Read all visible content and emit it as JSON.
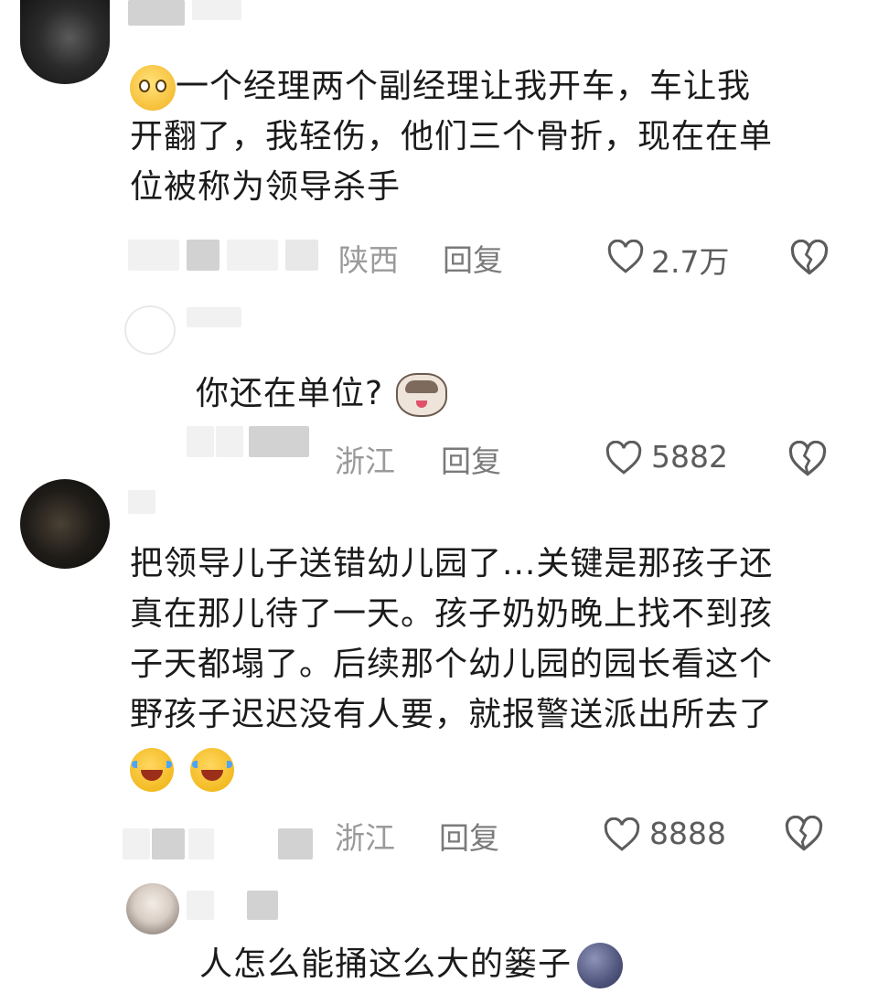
{
  "comments": [
    {
      "text": "一个经理两个副经理让我开车，车让我开翻了，我轻伤，他们三个骨折，现在在单位被称为领导杀手",
      "lines": [
        "一个经理两个副经理让我开车，车让我",
        "开翻了，我轻伤，他们三个骨折，现在在单",
        "位被称为领导杀手"
      ],
      "emoji_start": "pleading-face-icon",
      "location": "陕西",
      "reply_label": "回复",
      "likes": "2.7万"
    },
    {
      "text": "你还在单位?",
      "emoji_end": "cat-face-icon",
      "location": "浙江",
      "reply_label": "回复",
      "likes": "5882"
    },
    {
      "text": "把领导儿子送错幼儿园了...关键是那孩子还真在那儿待了一天。孩子奶奶晚上找不到孩子天都塌了。后续那个幼儿园的园长看这个野孩子迟迟没有人要，就报警送派出所去了",
      "lines": [
        "把领导儿子送错幼儿园了...关键是那孩子还",
        "真在那儿待了一天。孩子奶奶晚上找不到孩",
        "子天都塌了。后续那个幼儿园的园长看这个",
        "野孩子迟迟没有人要，就报警送派出所去了"
      ],
      "emoji_end": "laughing-crying-icon",
      "location": "浙江",
      "reply_label": "回复",
      "likes": "8888"
    },
    {
      "text": "人怎么能捅这么大的篓子",
      "emoji_end": "moon-face-icon"
    }
  ],
  "watermark": "　",
  "colors": {
    "meta": "#9a9a9a",
    "text": "#1b1b1b",
    "icon": "#5c5c5c"
  }
}
